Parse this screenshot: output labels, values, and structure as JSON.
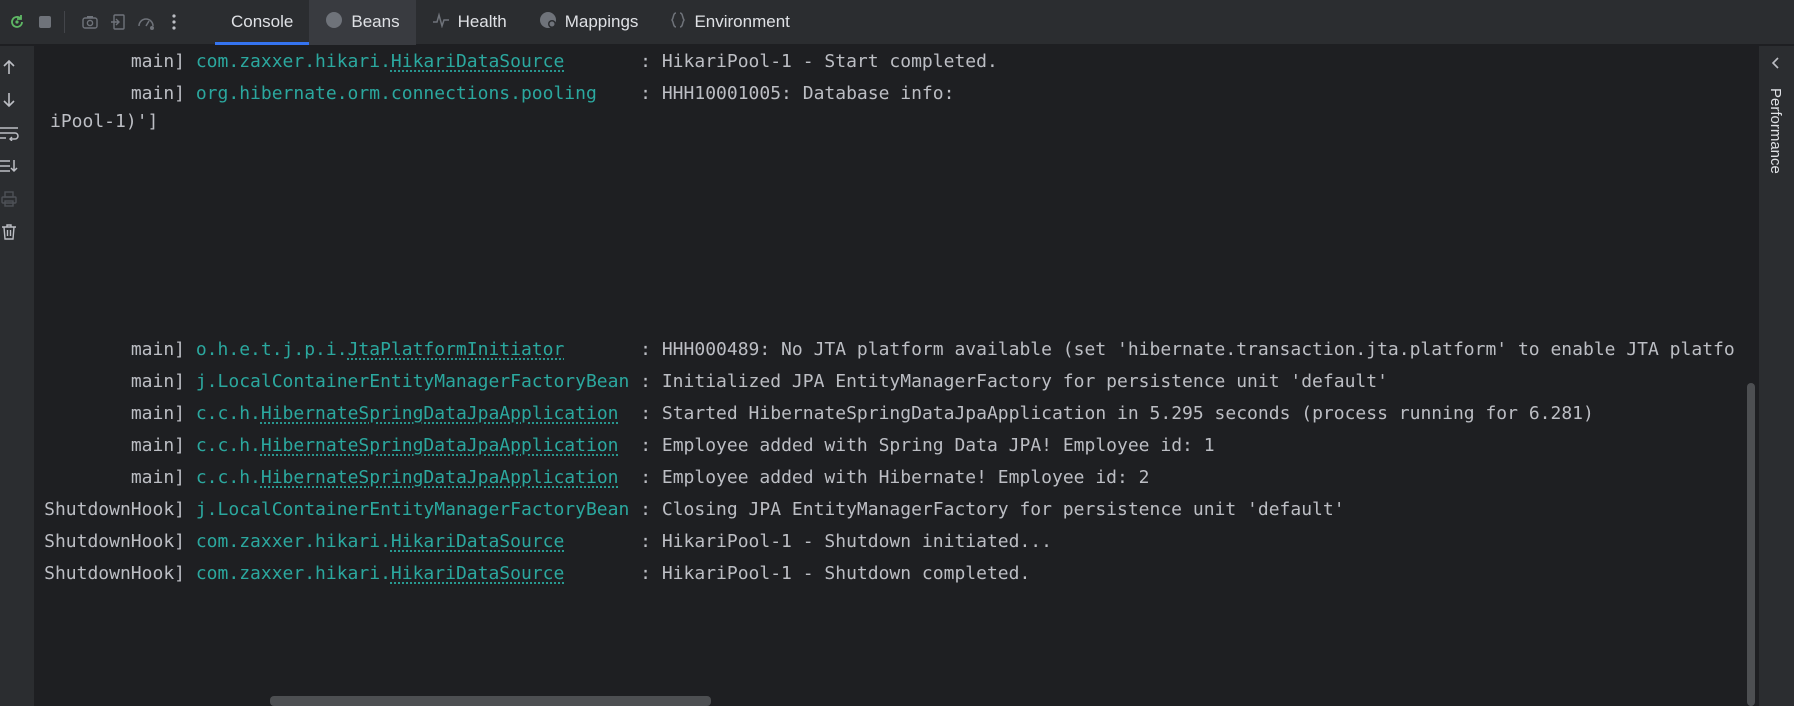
{
  "toolbar": {
    "icons": [
      "rerun-icon",
      "stop-icon",
      "camera-icon",
      "dump-threads-icon",
      "gauge-icon",
      "more-vert-icon"
    ],
    "tabs": [
      {
        "label": "Console",
        "icon": "",
        "active": true
      },
      {
        "label": "Beans",
        "icon": "beans-icon"
      },
      {
        "label": "Health",
        "icon": "health-icon"
      },
      {
        "label": "Mappings",
        "icon": "mappings-icon"
      },
      {
        "label": "Environment",
        "icon": "environment-icon"
      }
    ]
  },
  "left_tools": [
    "arrow-up-icon",
    "arrow-down-icon",
    "soft-wrap-icon",
    "scroll-to-end-icon",
    "print-icon",
    "trash-icon"
  ],
  "right_panel": {
    "label": "Performance"
  },
  "console": {
    "lines": [
      {
        "thread": "main]",
        "pkg": "com.zaxxer.hikari.",
        "cls": "HikariDataSource",
        "pad": "       ",
        "msg": ": HikariPool-1 - Start completed."
      },
      {
        "thread": "main]",
        "pkg": "org.hibernate.orm.connections.pooling",
        "cls": "",
        "pad": "    ",
        "msg": ": HHH10001005: Database info:"
      },
      {
        "text": "iPool-1)']"
      },
      {
        "thread": "main]",
        "pkg": "o.h.e.t.j.p.i.",
        "cls": "JtaPlatformInitiator",
        "pad": "       ",
        "msg": ": HHH000489: No JTA platform available (set 'hibernate.transaction.jta.platform' to enable JTA platfo"
      },
      {
        "thread": "main]",
        "pkg": "j.LocalContainerEntityManagerFactoryBean",
        "cls": "",
        "pad": " ",
        "msg": ": Initialized JPA EntityManagerFactory for persistence unit 'default'"
      },
      {
        "thread": "main]",
        "pkg": "c.c.h.",
        "cls": "HibernateSpringDataJpaApplication",
        "pad": "  ",
        "msg": ": Started HibernateSpringDataJpaApplication in 5.295 seconds (process running for 6.281)"
      },
      {
        "thread": "main]",
        "pkg": "c.c.h.",
        "cls": "HibernateSpringDataJpaApplication",
        "pad": "  ",
        "msg": ": Employee added with Spring Data JPA! Employee id: 1"
      },
      {
        "thread": "main]",
        "pkg": "c.c.h.",
        "cls": "HibernateSpringDataJpaApplication",
        "pad": "  ",
        "msg": ": Employee added with Hibernate! Employee id: 2"
      },
      {
        "thread": "ShutdownHook]",
        "pkg": "j.LocalContainerEntityManagerFactoryBean",
        "cls": "",
        "pad": " ",
        "msg": ": Closing JPA EntityManagerFactory for persistence unit 'default'"
      },
      {
        "thread": "ShutdownHook]",
        "pkg": "com.zaxxer.hikari.",
        "cls": "HikariDataSource",
        "pad": "       ",
        "msg": ": HikariPool-1 - Shutdown initiated..."
      },
      {
        "thread": "ShutdownHook]",
        "pkg": "com.zaxxer.hikari.",
        "cls": "HikariDataSource",
        "pad": "       ",
        "msg": ": HikariPool-1 - Shutdown completed."
      }
    ]
  }
}
